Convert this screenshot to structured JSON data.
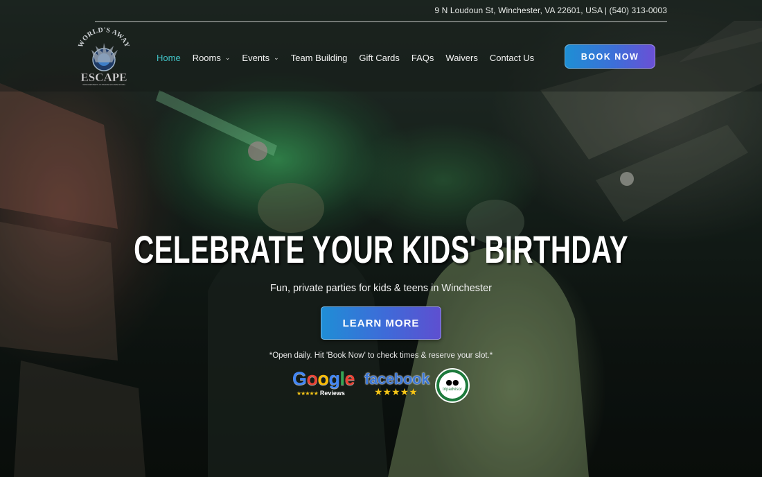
{
  "header": {
    "address": "9 N Loudoun St, Winchester, VA 22601, USA | (540) 313-0003",
    "logo": {
      "top_text": "WORLD'S AWAY",
      "main_text": "ESCAPE",
      "tagline": "WINCHESTER'S ULTIMATE ESCAPE ROOM"
    },
    "nav": [
      {
        "label": "Home",
        "active": true,
        "dropdown": false
      },
      {
        "label": "Rooms",
        "active": false,
        "dropdown": true
      },
      {
        "label": "Events",
        "active": false,
        "dropdown": true
      },
      {
        "label": "Team Building",
        "active": false,
        "dropdown": false
      },
      {
        "label": "Gift Cards",
        "active": false,
        "dropdown": false
      },
      {
        "label": "FAQs",
        "active": false,
        "dropdown": false
      },
      {
        "label": "Waivers",
        "active": false,
        "dropdown": false
      },
      {
        "label": "Contact Us",
        "active": false,
        "dropdown": false
      }
    ],
    "book_button": "BOOK NOW"
  },
  "hero": {
    "headline": "CELEBRATE YOUR KIDS' BIRTHDAY",
    "subtitle": "Fun, private parties for kids & teens in Winchester",
    "cta": "LEARN MORE",
    "note": "*Open daily. Hit 'Book Now' to check times & reserve your slot.*"
  },
  "reviews": {
    "google": {
      "word": "Google",
      "sub": "Reviews",
      "stars": "★★★★★"
    },
    "facebook": {
      "word": "facebook",
      "stars": "★★★★★"
    },
    "tripadvisor": {
      "name": "tripadvisor",
      "ring_text": "RECOMMENDED ON"
    }
  },
  "colors": {
    "active_nav": "#41c3c7",
    "button_gradient_start": "#1e8fd4",
    "button_gradient_end": "#6b4fd6",
    "google_blue": "#4285f4",
    "google_red": "#ea4335",
    "google_yellow": "#fbbc05",
    "google_green": "#34a853",
    "facebook_blue": "#3b77d6",
    "tripadvisor_green": "#1d7a3c"
  }
}
